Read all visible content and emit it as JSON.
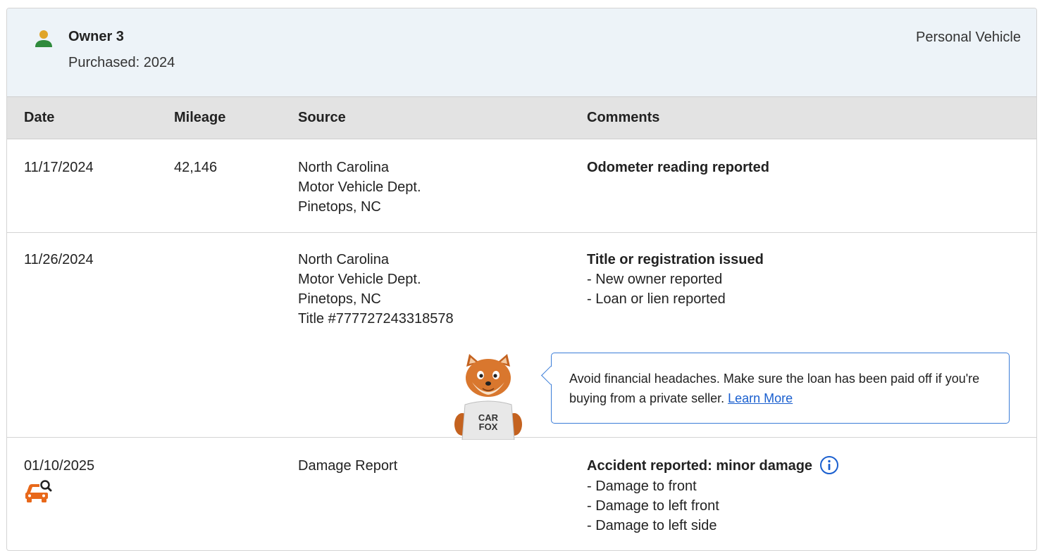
{
  "owner": {
    "name": "Owner 3",
    "purchased": "Purchased: 2024",
    "vehicle_type": "Personal Vehicle",
    "icon": "person-icon"
  },
  "table": {
    "headers": {
      "date": "Date",
      "mileage": "Mileage",
      "source": "Source",
      "comments": "Comments"
    },
    "rows": [
      {
        "date": "11/17/2024",
        "mileage": "42,146",
        "source": [
          "North Carolina",
          "Motor Vehicle Dept.",
          "Pinetops, NC"
        ],
        "comment_title": "Odometer reading reported",
        "comment_items": []
      },
      {
        "date": "11/26/2024",
        "mileage": "",
        "source": [
          "North Carolina",
          "Motor Vehicle Dept.",
          "Pinetops, NC",
          "Title #777727243318578"
        ],
        "comment_title": "Title or registration issued",
        "comment_items": [
          "- New owner reported",
          "- Loan or lien reported"
        ]
      },
      {
        "date": "01/10/2025",
        "mileage": "",
        "source": [
          "Damage Report"
        ],
        "comment_title": "Accident reported: minor damage",
        "comment_items": [
          "- Damage to front",
          "- Damage to left front",
          "- Damage to left side"
        ]
      }
    ]
  },
  "tip": {
    "text": "Avoid financial headaches. Make sure the loan has been paid off if you're buying from a private seller.",
    "link": "Learn More",
    "mascot_shirt": "CAR FOX"
  },
  "colors": {
    "header_bg": "#edf3f8",
    "table_head_bg": "#e3e3e3",
    "accent_blue": "#1a5fcf",
    "damage_orange": "#e8681a",
    "person_green": "#2f8a3c",
    "person_gold": "#e0a52a"
  }
}
